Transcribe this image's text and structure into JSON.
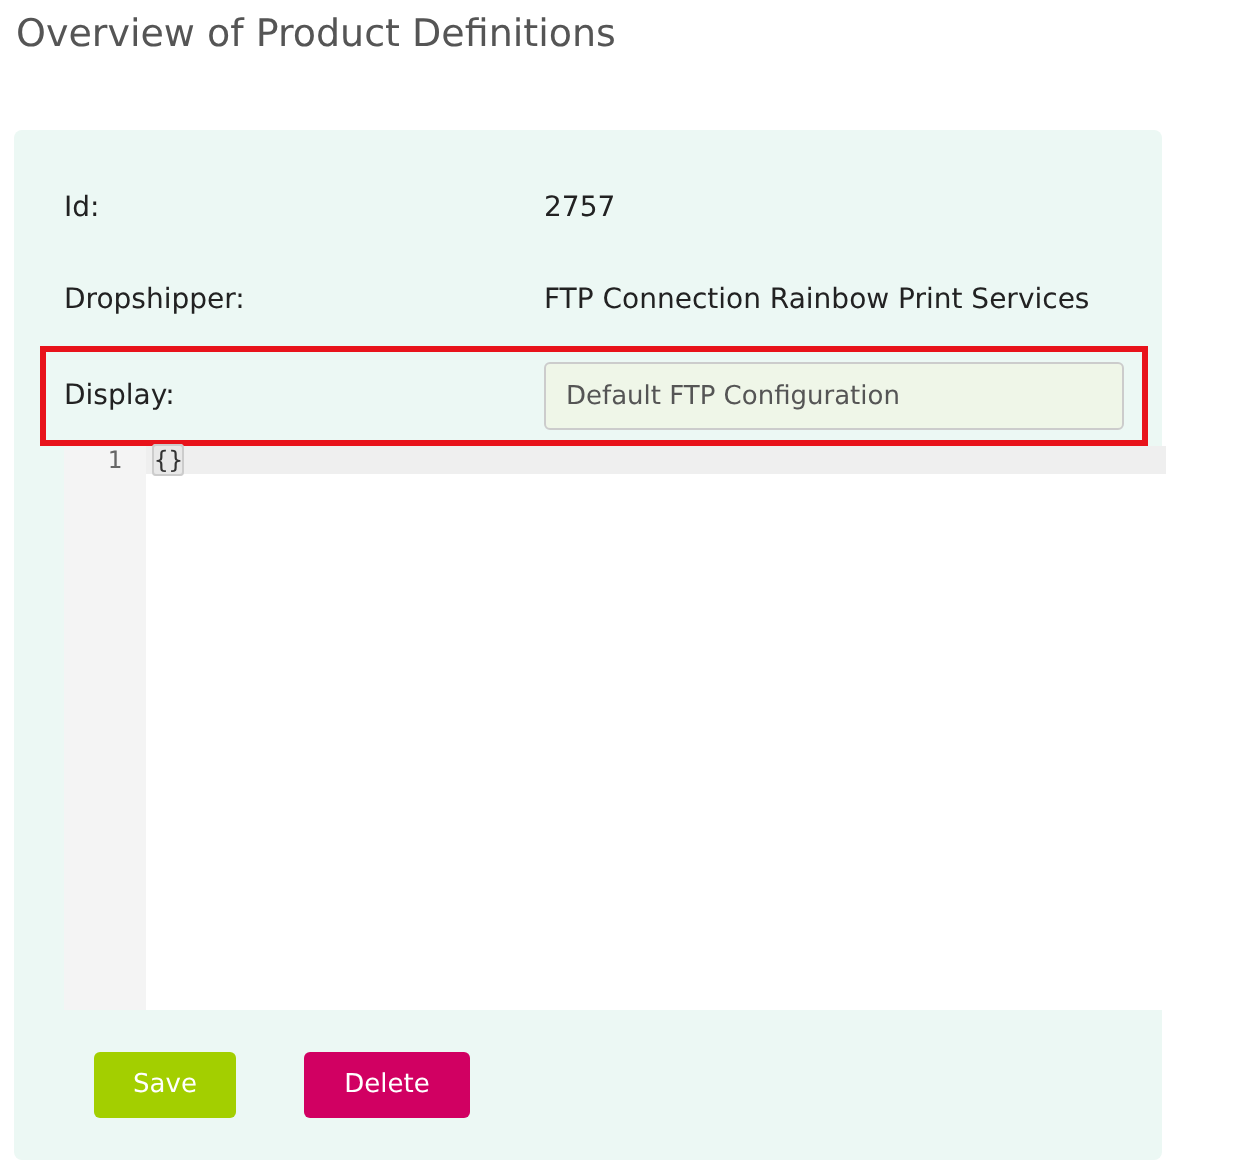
{
  "page_title": "Overview of Product Definitions",
  "fields": [
    {
      "label": "Id:",
      "kind": "text",
      "value": "2757",
      "highlighted": false
    },
    {
      "label": "Dropshipper:",
      "kind": "text",
      "value": "FTP Connection Rainbow Print Services",
      "highlighted": false
    },
    {
      "label": "Display:",
      "kind": "input",
      "value": "Default FTP Configuration",
      "highlighted": true
    }
  ],
  "editor": {
    "lines": [
      {
        "number": "1",
        "code": "{}",
        "selected": true
      }
    ]
  },
  "buttons": [
    {
      "label": "Save",
      "kind": "primary"
    },
    {
      "label": "Delete",
      "kind": "danger"
    }
  ]
}
